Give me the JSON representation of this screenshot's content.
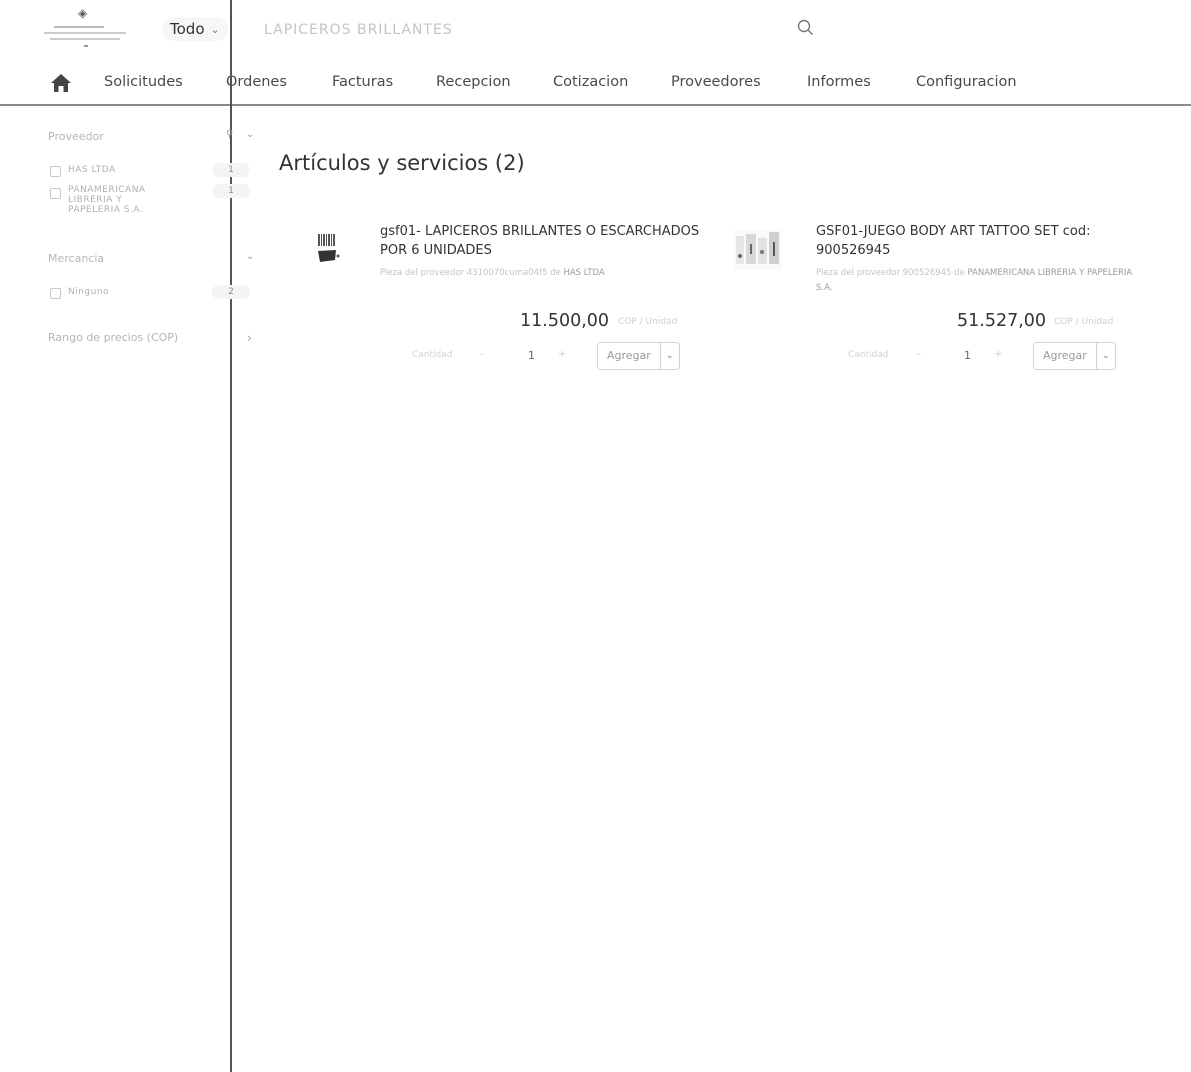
{
  "header": {
    "scope_label": "Todo",
    "search_value": "LAPICEROS BRILLANTES"
  },
  "nav": {
    "items": [
      "Solicitudes",
      "Ordenes",
      "Facturas",
      "Recepcion",
      "Cotizacion",
      "Proveedores",
      "Informes",
      "Configuracion"
    ]
  },
  "sidebar": {
    "proveedor": {
      "title": "Proveedor",
      "options": [
        {
          "label": "HAS LTDA",
          "count": "1"
        },
        {
          "label": "PANAMERICANA LIBRERIA Y PAPELERIA S.A.",
          "count": "1"
        }
      ]
    },
    "mercancia": {
      "title": "Mercancia",
      "options": [
        {
          "label": "Ninguno",
          "count": "2"
        }
      ]
    },
    "precio": {
      "title": "Rango de precios (COP)"
    }
  },
  "results": {
    "title": "Artículos y servicios (2)",
    "items": [
      {
        "title": "gsf01- LAPICEROS BRILLANTES O ESCARCHADOS POR 6 UNIDADES",
        "supplier_prefix": "Pieza del proveedor 4310070cuma04f5 de",
        "supplier_name": "HAS LTDA",
        "price": "11.500,00",
        "unit": "COP / Unidad",
        "qty_label": "Cantidad",
        "qty": "1",
        "add_label": "Agregar"
      },
      {
        "title": "GSF01-JUEGO BODY ART TATTOO SET cod: 900526945",
        "supplier_prefix": "Pieza del proveedor 900526945 de",
        "supplier_name": "PANAMERICANA LIBRERIA Y PAPELERIA S.A.",
        "price": "51.527,00",
        "unit": "COP / Unidad",
        "qty_label": "Cantidad",
        "qty": "1",
        "add_label": "Agregar"
      }
    ]
  }
}
